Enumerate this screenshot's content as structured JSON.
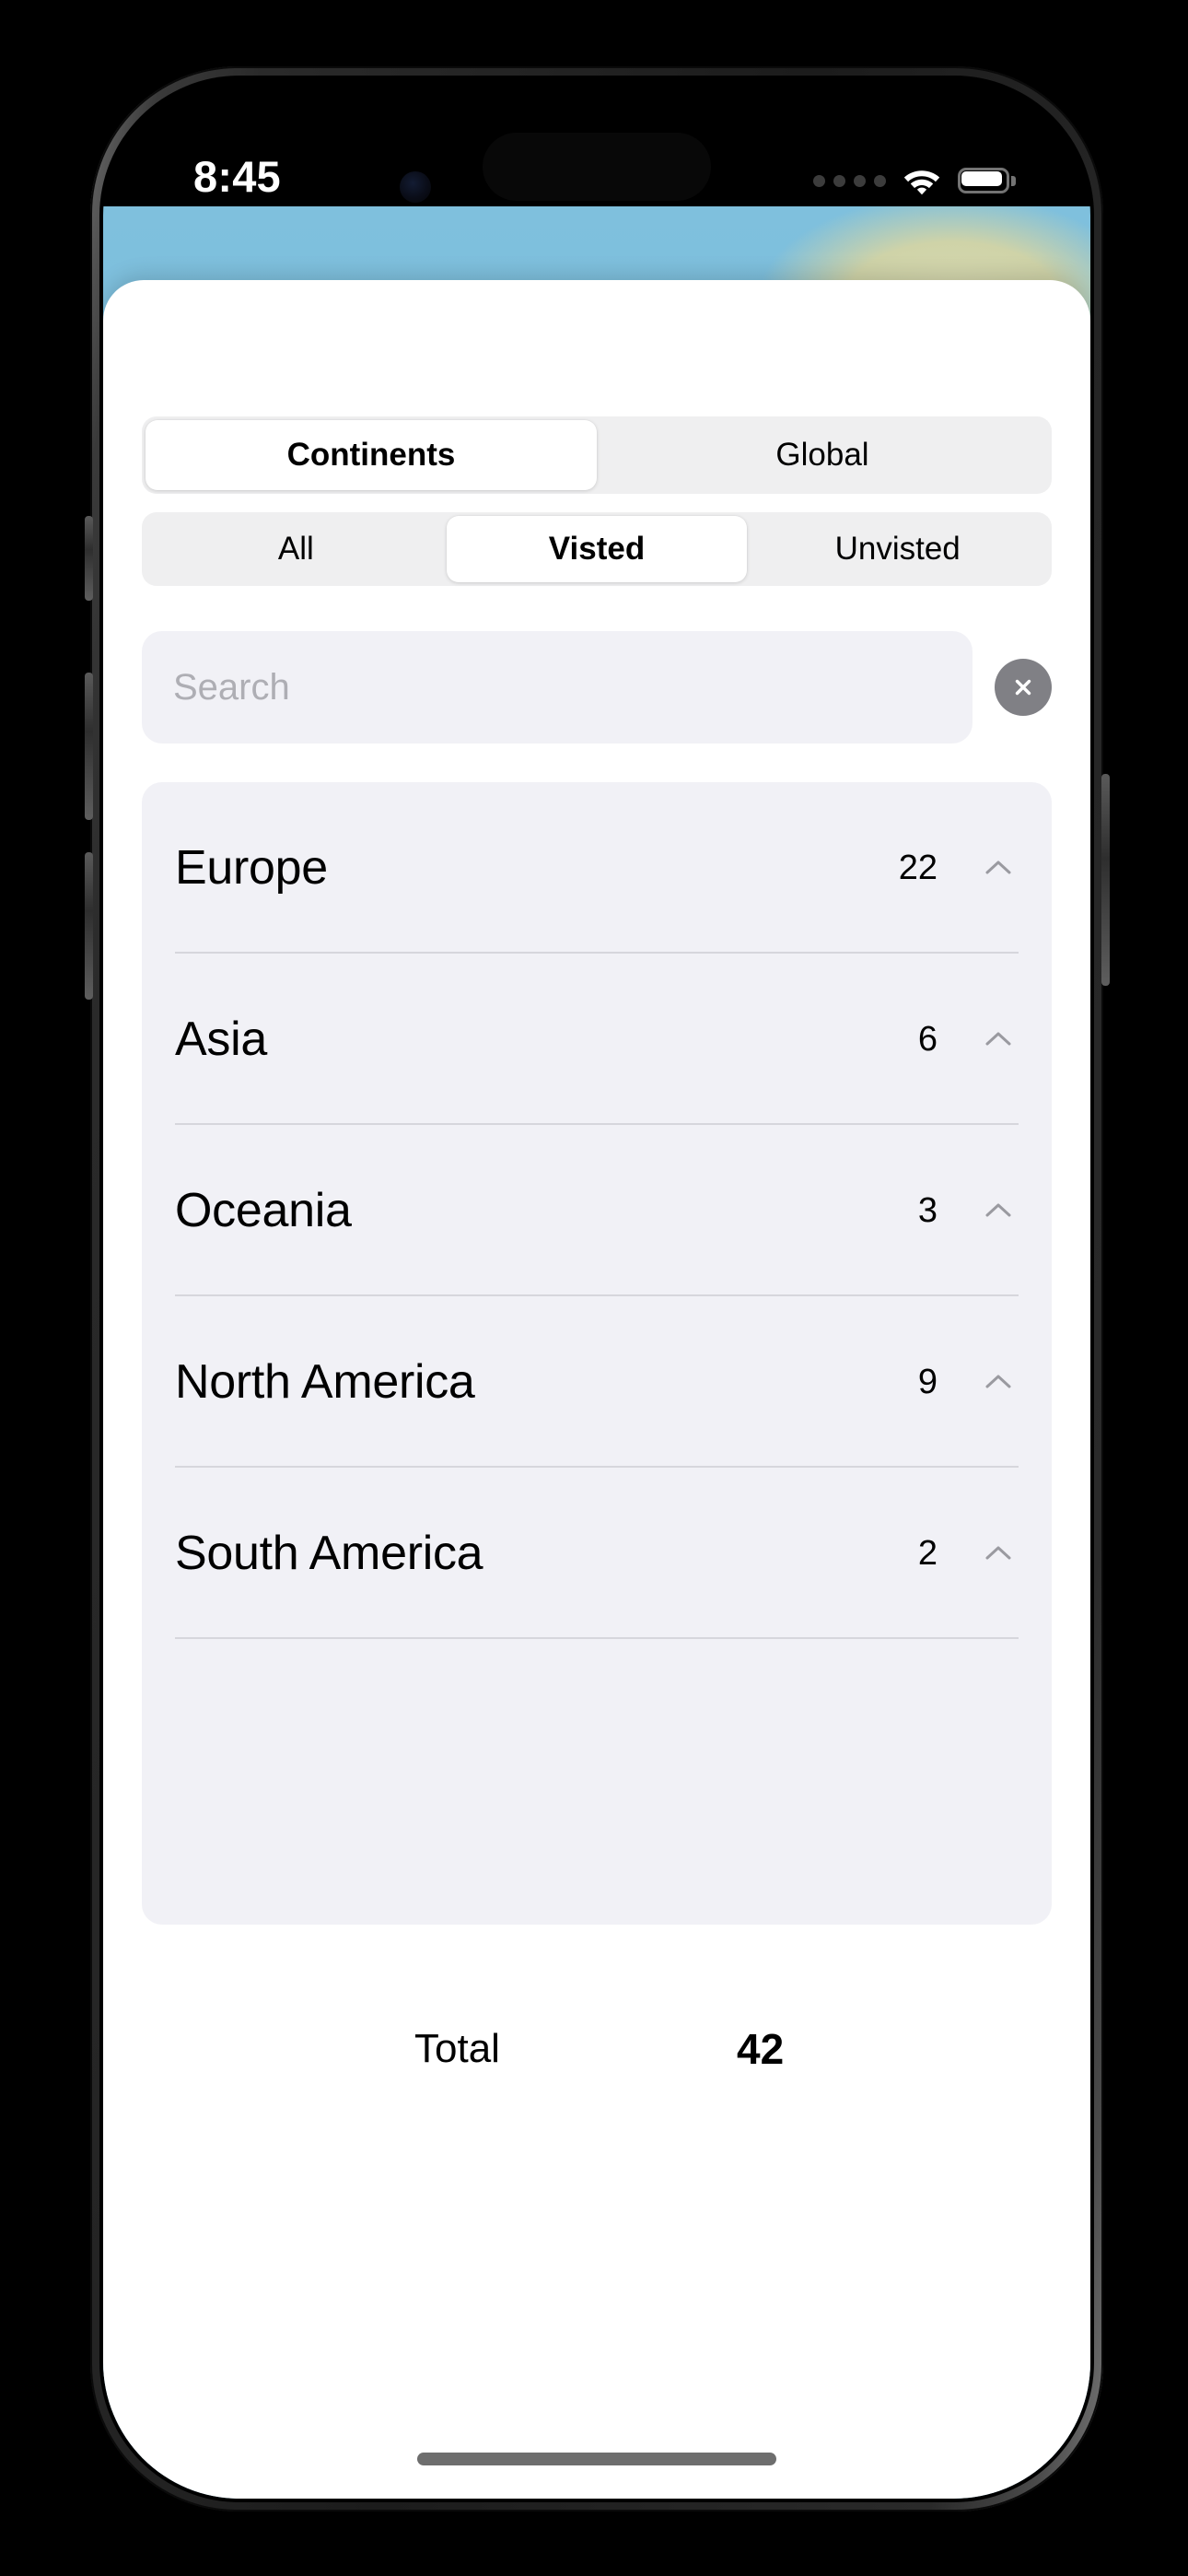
{
  "status_bar": {
    "time": "8:45",
    "cellular_icon": "cellular-dots-icon",
    "wifi_icon": "wifi-icon",
    "battery_icon": "battery-icon"
  },
  "sheet": {
    "scope_segmented": {
      "name": "scope-segmented-control",
      "selected": "Continents",
      "options": [
        {
          "label": "Continents",
          "selected": true
        },
        {
          "label": "Global",
          "selected": false
        }
      ]
    },
    "filter_segmented": {
      "name": "filter-segmented-control",
      "selected": "Visted",
      "options": [
        {
          "label": "All",
          "selected": false
        },
        {
          "label": "Visted",
          "selected": true
        },
        {
          "label": "Unvisted",
          "selected": false
        }
      ]
    },
    "search": {
      "placeholder": "Search",
      "value": "",
      "clear_icon": "close-circle-icon"
    },
    "continents": [
      {
        "name": "Europe",
        "count": "22",
        "chevron": "chevron-up-icon"
      },
      {
        "name": "Asia",
        "count": "6",
        "chevron": "chevron-up-icon"
      },
      {
        "name": "Oceania",
        "count": "3",
        "chevron": "chevron-up-icon"
      },
      {
        "name": "North America",
        "count": "9",
        "chevron": "chevron-up-icon"
      },
      {
        "name": "South America",
        "count": "2",
        "chevron": "chevron-up-icon"
      }
    ],
    "total": {
      "label": "Total",
      "value": "42"
    }
  },
  "colors": {
    "sheet_background": "#ffffff",
    "card_background": "#f1f1f6",
    "segment_track": "#efeff0",
    "segment_selected": "#ffffff",
    "divider": "#d6d6dc",
    "placeholder": "#aeaeb4",
    "clear_button": "#808085",
    "chevron": "#9a9aa0",
    "map_ocean": "#73b7d8",
    "text_primary": "#000000"
  }
}
